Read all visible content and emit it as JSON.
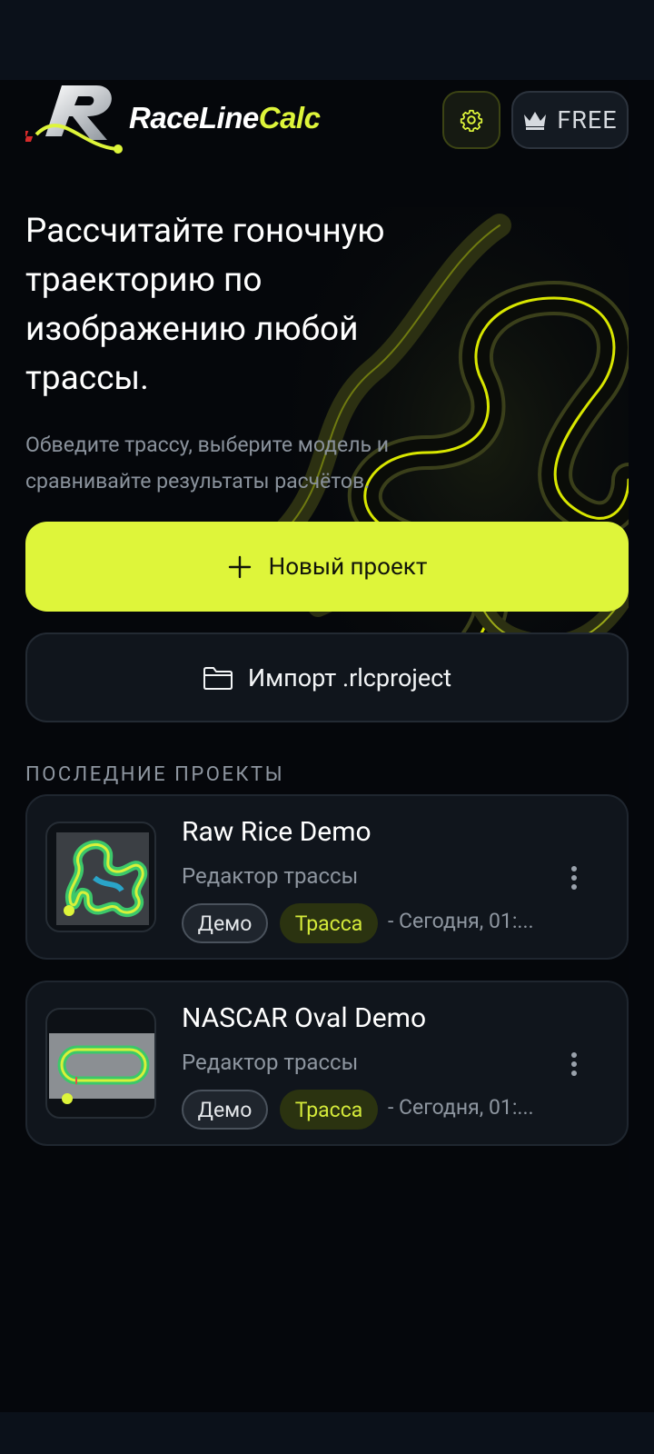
{
  "app": {
    "logo_text_white": "RaceLine",
    "logo_text_green": "Calc",
    "plan_label": "FREE"
  },
  "hero": {
    "title": "Рассчитайте гоночную траекторию по изображению любой трассы.",
    "subtitle": "Обведите трассу, выберите модель и сравнивайте результаты расчётов."
  },
  "actions": {
    "new_project": "Новый проект",
    "import_project": "Импорт .rlcproject"
  },
  "recent": {
    "section_title": "ПОСЛЕДНИЕ ПРОЕКТЫ",
    "projects": [
      {
        "title": "Raw Rice Demo",
        "type": "Редактор трассы",
        "tag_demo": "Демо",
        "tag_kind": "Трасса",
        "date": "- Сегодня, 01:..."
      },
      {
        "title": "NASCAR Oval Demo",
        "type": "Редактор трассы",
        "tag_demo": "Демо",
        "tag_kind": "Трасса",
        "date": "- Сегодня, 01:..."
      }
    ]
  },
  "icons": {
    "settings": "gear-icon",
    "plan": "crown-icon",
    "new": "plus-icon",
    "import": "folder-icon",
    "more": "more-vertical-icon"
  },
  "colors": {
    "accent": "#def53a",
    "background": "#05070b",
    "card": "#10151c"
  }
}
